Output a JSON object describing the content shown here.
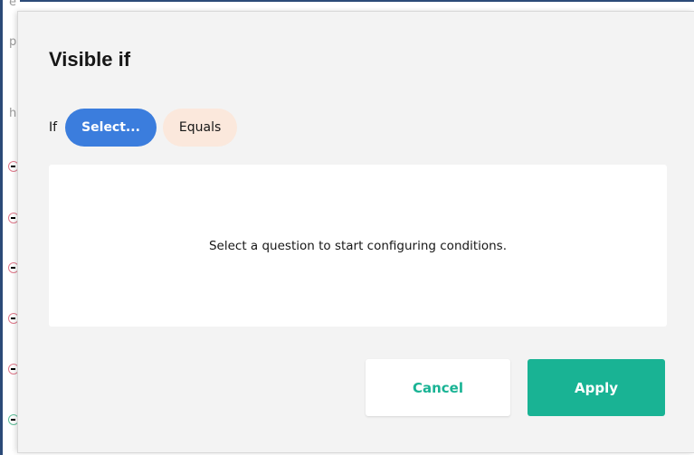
{
  "background": {
    "edge_chars": [
      "e",
      "p",
      "h"
    ]
  },
  "dialog": {
    "title": "Visible if",
    "condition": {
      "if_label": "If",
      "question_select": "Select...",
      "operator_select": "Equals"
    },
    "empty_message": "Select a question to start configuring conditions.",
    "buttons": {
      "cancel": "Cancel",
      "apply": "Apply"
    }
  },
  "colors": {
    "accent": "#19b394",
    "select_pill": "#3b7ddd",
    "operator_pill": "#fbe8dc",
    "dialog_bg": "#f3f3f3"
  }
}
